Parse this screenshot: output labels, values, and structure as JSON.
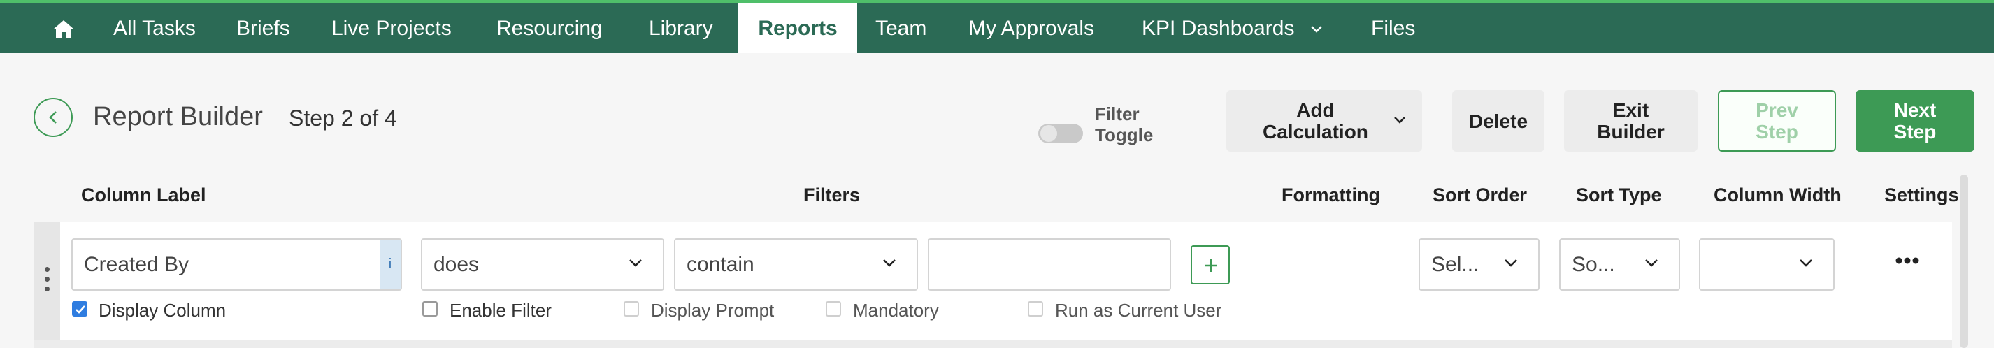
{
  "nav": {
    "home_icon": "home-icon",
    "items": [
      {
        "label": "All Tasks"
      },
      {
        "label": "Briefs"
      },
      {
        "label": "Live Projects"
      },
      {
        "label": "Resourcing"
      },
      {
        "label": "Library"
      },
      {
        "label": "Reports",
        "active": true
      },
      {
        "label": "Team"
      },
      {
        "label": "My Approvals"
      },
      {
        "label": "KPI Dashboards",
        "has_dropdown": true
      },
      {
        "label": "Files"
      }
    ]
  },
  "header": {
    "title": "Report Builder",
    "step": "Step 2 of 4",
    "filter_toggle": {
      "line1": "Filter",
      "line2": "Toggle",
      "on": false
    },
    "buttons": {
      "add_calc_line1": "Add",
      "add_calc_line2": "Calculation",
      "delete": "Delete",
      "exit_line1": "Exit",
      "exit_line2": "Builder",
      "prev_line1": "Prev",
      "prev_line2": "Step",
      "next_line1": "Next",
      "next_line2": "Step"
    }
  },
  "columns": {
    "column_label": "Column Label",
    "filters": "Filters",
    "formatting": "Formatting",
    "sort_order": "Sort Order",
    "sort_type": "Sort Type",
    "column_width": "Column Width",
    "settings": "Settings"
  },
  "row": {
    "column_label_value": "Created By",
    "info_badge": "i",
    "filter_operator": "does",
    "filter_condition": "contain",
    "filter_value": "",
    "sort_order_value": "Sel...",
    "sort_type_value": "So...",
    "column_width_value": "",
    "checkboxes": {
      "display_column": {
        "label": "Display Column",
        "checked": true
      },
      "enable_filter": {
        "label": "Enable Filter",
        "checked": false
      },
      "display_prompt": {
        "label": "Display Prompt",
        "checked": false
      },
      "mandatory": {
        "label": "Mandatory",
        "checked": false
      },
      "run_as_current_user": {
        "label": "Run as Current User",
        "checked": false
      }
    }
  },
  "colors": {
    "nav_bg": "#2b6a55",
    "nav_accent": "#4fbf6a",
    "primary_green": "#3d9a55",
    "checkbox_blue": "#2f7de0"
  }
}
